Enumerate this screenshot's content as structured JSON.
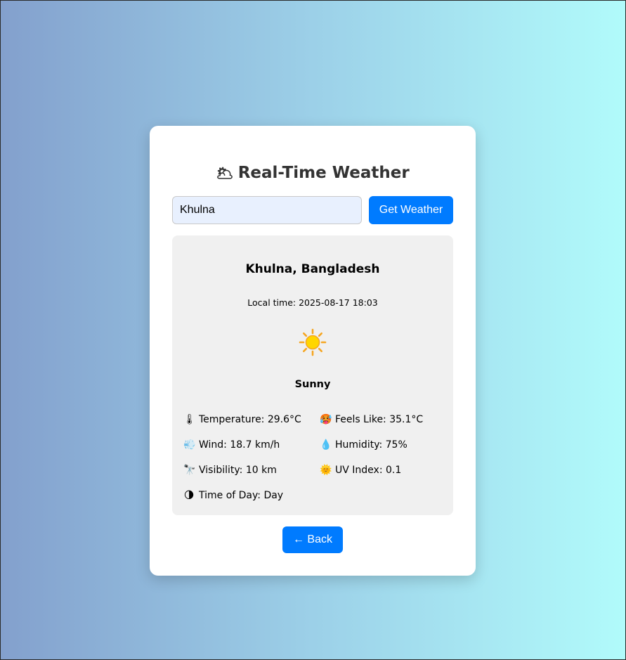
{
  "title": {
    "icon": "cloud-sun-icon",
    "text": "Real-Time Weather"
  },
  "search": {
    "value": "Khulna",
    "button_label": "Get Weather"
  },
  "weather": {
    "location": "Khulna, Bangladesh",
    "local_time": "Local time: 2025-08-17 18:03",
    "condition_icon": "sun-icon",
    "condition": "Sunny",
    "details": {
      "temperature": "Temperature: 29.6°C",
      "feels_like": "Feels Like: 35.1°C",
      "wind": "Wind: 18.7 km/h",
      "humidity": "Humidity: 75%",
      "visibility": "Visibility: 10 km",
      "uv_index": "UV Index: 0.1",
      "time_of_day": "Time of Day: Day"
    }
  },
  "back_button": {
    "label": "← Back"
  },
  "colors": {
    "accent": "#007bff",
    "card_bg": "#ffffff",
    "panel_bg": "#f0f0f0",
    "input_bg": "#e8f0fe",
    "gradient_start": "#83a0cd",
    "gradient_end": "#b1fbfb"
  }
}
